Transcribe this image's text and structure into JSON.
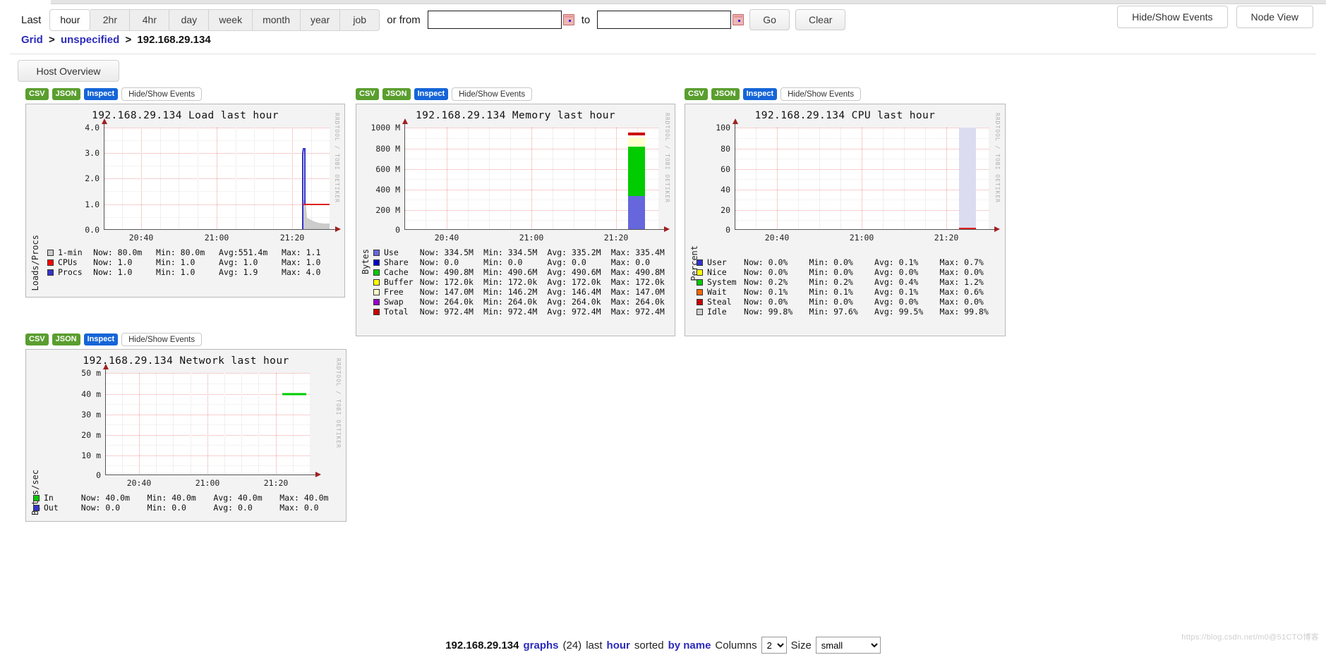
{
  "toolbar": {
    "last_label": "Last",
    "ranges": [
      {
        "label": "hour",
        "active": true
      },
      {
        "label": "2hr",
        "active": false
      },
      {
        "label": "4hr",
        "active": false
      },
      {
        "label": "day",
        "active": false
      },
      {
        "label": "week",
        "active": false
      },
      {
        "label": "month",
        "active": false
      },
      {
        "label": "year",
        "active": false
      },
      {
        "label": "job",
        "active": false
      }
    ],
    "or_from_label": "or from",
    "to_label": "to",
    "from_value": "",
    "to_value": "",
    "from_placeholder": "",
    "to_placeholder": "",
    "go_label": "Go",
    "clear_label": "Clear",
    "hide_show_events_label": "Hide/Show Events",
    "node_view_label": "Node View"
  },
  "breadcrumb": {
    "grid": "Grid",
    "cluster": "unspecified",
    "host": "192.168.29.134",
    "separator": ">"
  },
  "host_tab_label": "Host Overview",
  "panel_buttons": {
    "csv": "CSV",
    "json": "JSON",
    "inspect": "Inspect",
    "hide_show_events": "Hide/Show Events"
  },
  "watermark_text": "RRDTOOL / TOBI OETIKER",
  "page_watermark": "https://blog.csdn.net/m0@51CTO博客",
  "footer": {
    "host": "192.168.29.134",
    "graphs_label": "graphs",
    "count": "(24)",
    "last_label": "last",
    "range": "hour",
    "sorted_label": "sorted",
    "by_label": "by name",
    "columns_label": "Columns",
    "columns_value": "2",
    "size_label": "Size",
    "size_value": "small"
  },
  "chart_data": [
    {
      "id": "load",
      "type": "line",
      "title": "192.168.29.134 Load last hour",
      "ylabel": "Loads/Procs",
      "xlabel": "",
      "yticks": [
        "4.0",
        "3.0",
        "2.0",
        "1.0",
        "0.0"
      ],
      "ylim": [
        0,
        4
      ],
      "xticks": [
        "20:40",
        "21:00",
        "21:20"
      ],
      "grid": true,
      "legend": [
        {
          "name": "1-min",
          "color": "#c9c9c9",
          "now": "Now:  80.0m",
          "min": "Min:  80.0m",
          "avg": "Avg:551.4m",
          "max": "Max:   1.1"
        },
        {
          "name": "CPUs",
          "color": "#ff0000",
          "now": "Now:   1.0",
          "min": "Min:   1.0",
          "avg": "Avg:   1.0",
          "max": "Max:   1.0"
        },
        {
          "name": "Procs",
          "color": "#3333cc",
          "now": "Now:   1.0",
          "min": "Min:   1.0",
          "avg": "Avg:   1.9",
          "max": "Max:   4.0"
        }
      ]
    },
    {
      "id": "memory",
      "type": "area",
      "title": "192.168.29.134 Memory last hour",
      "ylabel": "Bytes",
      "xlabel": "",
      "yticks": [
        "1000 M",
        "800 M",
        "600 M",
        "400 M",
        "200 M",
        "0"
      ],
      "ylim": [
        0,
        1000
      ],
      "xticks": [
        "20:40",
        "21:00",
        "21:20"
      ],
      "grid": true,
      "legend": [
        {
          "name": "Use",
          "color": "#6666dd",
          "now": "Now: 334.5M",
          "min": "Min: 334.5M",
          "avg": "Avg: 335.2M",
          "max": "Max: 335.4M"
        },
        {
          "name": "Share",
          "color": "#0000cc",
          "now": "Now:    0.0",
          "min": "Min:    0.0",
          "avg": "Avg:    0.0",
          "max": "Max:    0.0"
        },
        {
          "name": "Cache",
          "color": "#00cc00",
          "now": "Now: 490.8M",
          "min": "Min: 490.6M",
          "avg": "Avg: 490.6M",
          "max": "Max: 490.8M"
        },
        {
          "name": "Buffer",
          "color": "#ffff00",
          "now": "Now: 172.0k",
          "min": "Min: 172.0k",
          "avg": "Avg: 172.0k",
          "max": "Max: 172.0k"
        },
        {
          "name": "Free",
          "color": "#ffffcc",
          "now": "Now: 147.0M",
          "min": "Min: 146.2M",
          "avg": "Avg: 146.4M",
          "max": "Max: 147.0M"
        },
        {
          "name": "Swap",
          "color": "#9900cc",
          "now": "Now: 264.0k",
          "min": "Min: 264.0k",
          "avg": "Avg: 264.0k",
          "max": "Max: 264.0k"
        },
        {
          "name": "Total",
          "color": "#cc0000",
          "now": "Now: 972.4M",
          "min": "Min: 972.4M",
          "avg": "Avg: 972.4M",
          "max": "Max: 972.4M"
        }
      ]
    },
    {
      "id": "cpu",
      "type": "area",
      "title": "192.168.29.134 CPU last hour",
      "ylabel": "Percent",
      "xlabel": "",
      "yticks": [
        "100",
        "80",
        "60",
        "40",
        "20",
        "0"
      ],
      "ylim": [
        0,
        100
      ],
      "xticks": [
        "20:40",
        "21:00",
        "21:20"
      ],
      "grid": true,
      "legend": [
        {
          "name": "User",
          "color": "#3333cc",
          "now": "Now:   0.0%",
          "min": "Min:   0.0%",
          "avg": "Avg:   0.1%",
          "max": "Max:   0.7%"
        },
        {
          "name": "Nice",
          "color": "#ffff00",
          "now": "Now:   0.0%",
          "min": "Min:   0.0%",
          "avg": "Avg:   0.0%",
          "max": "Max:   0.0%"
        },
        {
          "name": "System",
          "color": "#00cc00",
          "now": "Now:   0.2%",
          "min": "Min:   0.2%",
          "avg": "Avg:   0.4%",
          "max": "Max:   1.2%"
        },
        {
          "name": "Wait",
          "color": "#ff6600",
          "now": "Now:   0.1%",
          "min": "Min:   0.1%",
          "avg": "Avg:   0.1%",
          "max": "Max:   0.6%"
        },
        {
          "name": "Steal",
          "color": "#cc0000",
          "now": "Now:   0.0%",
          "min": "Min:   0.0%",
          "avg": "Avg:   0.0%",
          "max": "Max:   0.0%"
        },
        {
          "name": "Idle",
          "color": "#cccccc",
          "now": "Now:  99.8%",
          "min": "Min:  97.6%",
          "avg": "Avg:  99.5%",
          "max": "Max:  99.8%"
        }
      ]
    },
    {
      "id": "network",
      "type": "line",
      "title": "192.168.29.134 Network last hour",
      "ylabel": "Bytes/sec",
      "xlabel": "",
      "yticks": [
        "50 m",
        "40 m",
        "30 m",
        "20 m",
        "10 m",
        "0"
      ],
      "ylim": [
        0,
        50
      ],
      "xticks": [
        "20:40",
        "21:00",
        "21:20"
      ],
      "grid": true,
      "legend": [
        {
          "name": "In",
          "color": "#00cc00",
          "now": "Now:  40.0m",
          "min": "Min:  40.0m",
          "avg": "Avg:  40.0m",
          "max": "Max:  40.0m"
        },
        {
          "name": "Out",
          "color": "#3333cc",
          "now": "Now:   0.0",
          "min": "Min:   0.0",
          "avg": "Avg:   0.0",
          "max": "Max:   0.0"
        }
      ]
    }
  ]
}
